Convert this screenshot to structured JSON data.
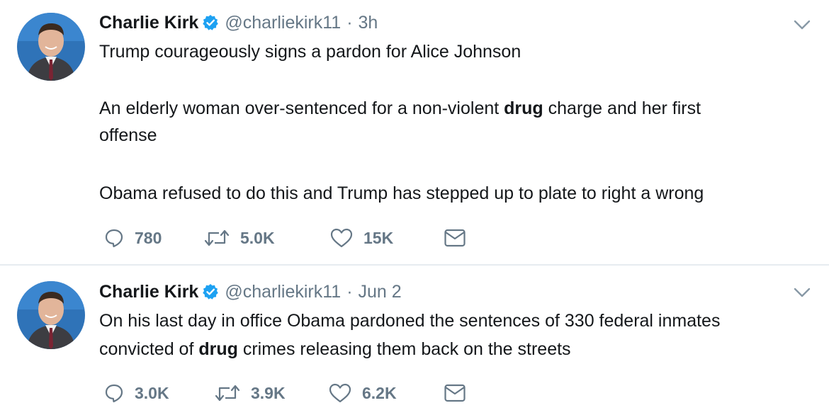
{
  "tweets": [
    {
      "author_name": "Charlie Kirk",
      "handle": "@charliekirk11",
      "separator": "·",
      "time": "3h",
      "text": [
        [
          {
            "t": "Trump courageously signs a pardon for Alice Johnson"
          }
        ],
        [
          {
            "t": "An elderly woman over-sentenced for a non-violent "
          },
          {
            "t": "drug",
            "b": true
          },
          {
            "t": " charge and her first"
          }
        ],
        [
          {
            "t": "offense"
          }
        ],
        [
          {
            "t": "Obama refused to do this and Trump has stepped up to plate to right a wrong"
          }
        ]
      ],
      "replies": "780",
      "retweets": "5.0K",
      "likes": "15K"
    },
    {
      "author_name": "Charlie Kirk",
      "handle": "@charliekirk11",
      "separator": "·",
      "time": "Jun 2",
      "text": [
        [
          {
            "t": "On his last day in office Obama pardoned the sentences of 330 federal inmates"
          }
        ],
        [
          {
            "t": "convicted of "
          },
          {
            "t": "drug",
            "b": true
          },
          {
            "t": " crimes releasing them back on the streets"
          }
        ]
      ],
      "replies": "3.0K",
      "retweets": "3.9K",
      "likes": "6.2K"
    }
  ],
  "icons": {
    "verified": "verified-badge-icon",
    "caret": "chevron-down-icon",
    "reply": "reply-icon",
    "retweet": "retweet-icon",
    "like": "heart-icon",
    "dm": "envelope-icon"
  },
  "colors": {
    "text": "#14171a",
    "muted": "#657786",
    "verified": "#1da1f2",
    "divider": "#e6ecf0"
  }
}
